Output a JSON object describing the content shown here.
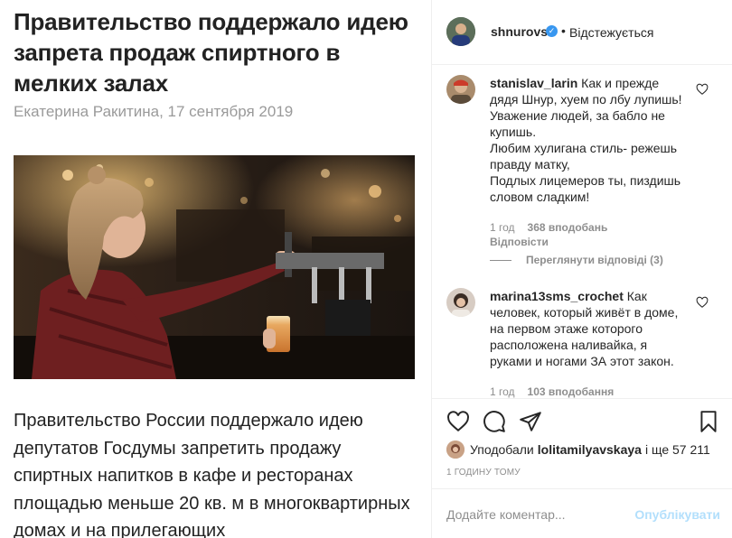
{
  "article": {
    "title": "Правительство поддержало идею запрета продаж спиртного в мелких залах",
    "byline": "Екатерина Ракитина, 17 сентября 2019",
    "body": "Правительство России поддержало идею депутатов Госдумы запретить продажу спиртных напитков в кафе и ресторанах площадью меньше 20 кв. м в многоквартирных домах и на прилегающих"
  },
  "post": {
    "username": "shnurovs",
    "separator": "•",
    "follow_status": "Відстежується",
    "comments": [
      {
        "username": "stanislav_larin",
        "text": "Как и прежде дядя Шнур, хуем по лбу лупишь! Уважение людей, за бабло не купишь.\nЛюбим хулигана стиль- режешь правду матку,\nПодлых лицемеров ты, пиздишь словом сладким!",
        "age": "1 год",
        "likes": "368 вподобань",
        "reply_label": "Відповісти",
        "view_replies": "Переглянути відповіді (3)"
      },
      {
        "username": "marina13sms_crochet",
        "text": "Как человек, который живёт в доме, на первом этаже которого расположена наливайка, я руками и ногами ЗА этот закон.",
        "age": "1 год",
        "likes": "103 вподобання"
      }
    ],
    "likes_prefix": "Уподобали",
    "likes_user": "lolitamilyavskaya",
    "likes_suffix": "і ще 57 211",
    "timestamp": "1 ГОДИНУ ТОМУ",
    "comment_placeholder": "Додайте коментар...",
    "post_button": "Опублікувати"
  },
  "icons": {
    "verified": "verified-badge-icon",
    "heart": "heart-icon",
    "comment": "comment-icon",
    "share": "share-icon",
    "save": "bookmark-icon"
  },
  "colors": {
    "accent": "#3897f0",
    "post_button_disabled": "#b2dffc",
    "muted": "#8e8e8e"
  }
}
